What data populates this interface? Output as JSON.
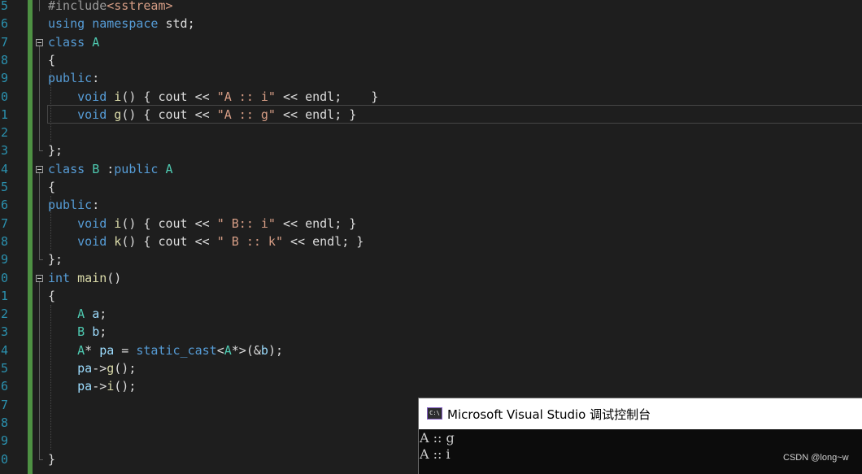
{
  "editor": {
    "line_numbers": [
      "5",
      "6",
      "7",
      "8",
      "9",
      "0",
      "1",
      "2",
      "3",
      "4",
      "5",
      "6",
      "7",
      "8",
      "9",
      "0",
      "1",
      "2",
      "3",
      "4",
      "5",
      "6",
      "7",
      "8",
      "9",
      "0"
    ],
    "code_lines": [
      [
        {
          "t": "#include",
          "c": "preproc"
        },
        {
          "t": "<sstream>",
          "c": "include"
        }
      ],
      [
        {
          "t": "using",
          "c": "keyword"
        },
        {
          "t": " ",
          "c": "text"
        },
        {
          "t": "namespace",
          "c": "keyword"
        },
        {
          "t": " std;",
          "c": "text"
        }
      ],
      [
        {
          "t": "class",
          "c": "keyword"
        },
        {
          "t": " ",
          "c": "text"
        },
        {
          "t": "A",
          "c": "type"
        }
      ],
      [
        {
          "t": "{",
          "c": "text"
        }
      ],
      [
        {
          "t": "public",
          "c": "keyword"
        },
        {
          "t": ":",
          "c": "text"
        }
      ],
      [
        {
          "t": "    ",
          "c": "text"
        },
        {
          "t": "void",
          "c": "keyword"
        },
        {
          "t": " ",
          "c": "text"
        },
        {
          "t": "i",
          "c": "function"
        },
        {
          "t": "() { cout << ",
          "c": "text"
        },
        {
          "t": "\"A :: i\"",
          "c": "string"
        },
        {
          "t": " << endl;    }",
          "c": "text"
        }
      ],
      [
        {
          "t": "    ",
          "c": "text"
        },
        {
          "t": "void",
          "c": "keyword"
        },
        {
          "t": " ",
          "c": "text"
        },
        {
          "t": "g",
          "c": "function"
        },
        {
          "t": "() { cout << ",
          "c": "text"
        },
        {
          "t": "\"A :: g\"",
          "c": "string"
        },
        {
          "t": " << endl; }",
          "c": "text"
        }
      ],
      [],
      [
        {
          "t": "};",
          "c": "text"
        }
      ],
      [
        {
          "t": "class",
          "c": "keyword"
        },
        {
          "t": " ",
          "c": "text"
        },
        {
          "t": "B",
          "c": "type"
        },
        {
          "t": " :",
          "c": "text"
        },
        {
          "t": "public",
          "c": "keyword"
        },
        {
          "t": " ",
          "c": "text"
        },
        {
          "t": "A",
          "c": "type"
        }
      ],
      [
        {
          "t": "{",
          "c": "text"
        }
      ],
      [
        {
          "t": "public",
          "c": "keyword"
        },
        {
          "t": ":",
          "c": "text"
        }
      ],
      [
        {
          "t": "    ",
          "c": "text"
        },
        {
          "t": "void",
          "c": "keyword"
        },
        {
          "t": " ",
          "c": "text"
        },
        {
          "t": "i",
          "c": "function"
        },
        {
          "t": "() { cout << ",
          "c": "text"
        },
        {
          "t": "\" B:: i\"",
          "c": "string"
        },
        {
          "t": " << endl; }",
          "c": "text"
        }
      ],
      [
        {
          "t": "    ",
          "c": "text"
        },
        {
          "t": "void",
          "c": "keyword"
        },
        {
          "t": " ",
          "c": "text"
        },
        {
          "t": "k",
          "c": "function"
        },
        {
          "t": "() { cout << ",
          "c": "text"
        },
        {
          "t": "\" B :: k\"",
          "c": "string"
        },
        {
          "t": " << endl; }",
          "c": "text"
        }
      ],
      [
        {
          "t": "};",
          "c": "text"
        }
      ],
      [
        {
          "t": "int",
          "c": "keyword"
        },
        {
          "t": " ",
          "c": "text"
        },
        {
          "t": "main",
          "c": "function"
        },
        {
          "t": "()",
          "c": "text"
        }
      ],
      [
        {
          "t": "{",
          "c": "text"
        }
      ],
      [
        {
          "t": "    ",
          "c": "text"
        },
        {
          "t": "A",
          "c": "type"
        },
        {
          "t": " ",
          "c": "text"
        },
        {
          "t": "a",
          "c": "variable"
        },
        {
          "t": ";",
          "c": "text"
        }
      ],
      [
        {
          "t": "    ",
          "c": "text"
        },
        {
          "t": "B",
          "c": "type"
        },
        {
          "t": " ",
          "c": "text"
        },
        {
          "t": "b",
          "c": "variable"
        },
        {
          "t": ";",
          "c": "text"
        }
      ],
      [
        {
          "t": "    ",
          "c": "text"
        },
        {
          "t": "A",
          "c": "type"
        },
        {
          "t": "* ",
          "c": "text"
        },
        {
          "t": "pa",
          "c": "variable"
        },
        {
          "t": " = ",
          "c": "text"
        },
        {
          "t": "static_cast",
          "c": "keyword"
        },
        {
          "t": "<",
          "c": "text"
        },
        {
          "t": "A",
          "c": "type"
        },
        {
          "t": "*>(&",
          "c": "text"
        },
        {
          "t": "b",
          "c": "variable"
        },
        {
          "t": ");",
          "c": "text"
        }
      ],
      [
        {
          "t": "    ",
          "c": "text"
        },
        {
          "t": "pa",
          "c": "variable"
        },
        {
          "t": "->",
          "c": "text"
        },
        {
          "t": "g",
          "c": "function"
        },
        {
          "t": "();",
          "c": "text"
        }
      ],
      [
        {
          "t": "    ",
          "c": "text"
        },
        {
          "t": "pa",
          "c": "variable"
        },
        {
          "t": "->",
          "c": "text"
        },
        {
          "t": "i",
          "c": "function"
        },
        {
          "t": "();",
          "c": "text"
        }
      ],
      [],
      [],
      [],
      [
        {
          "t": "}",
          "c": "text"
        }
      ]
    ]
  },
  "console": {
    "icon_label": "C:\\",
    "title": "Microsoft Visual Studio 调试控制台",
    "output": [
      "A :: g",
      "A :: i"
    ]
  },
  "watermark": "CSDN @long~w",
  "colors": {
    "background": "#1e1e1e",
    "keyword": "#569cd6",
    "type": "#4ec9b0",
    "string": "#d69d85",
    "function": "#dcdcaa",
    "variable": "#9cdcfe",
    "line_number": "#2b91af",
    "change_bar": "#57a64a",
    "console_bg": "#0c0c0c"
  }
}
